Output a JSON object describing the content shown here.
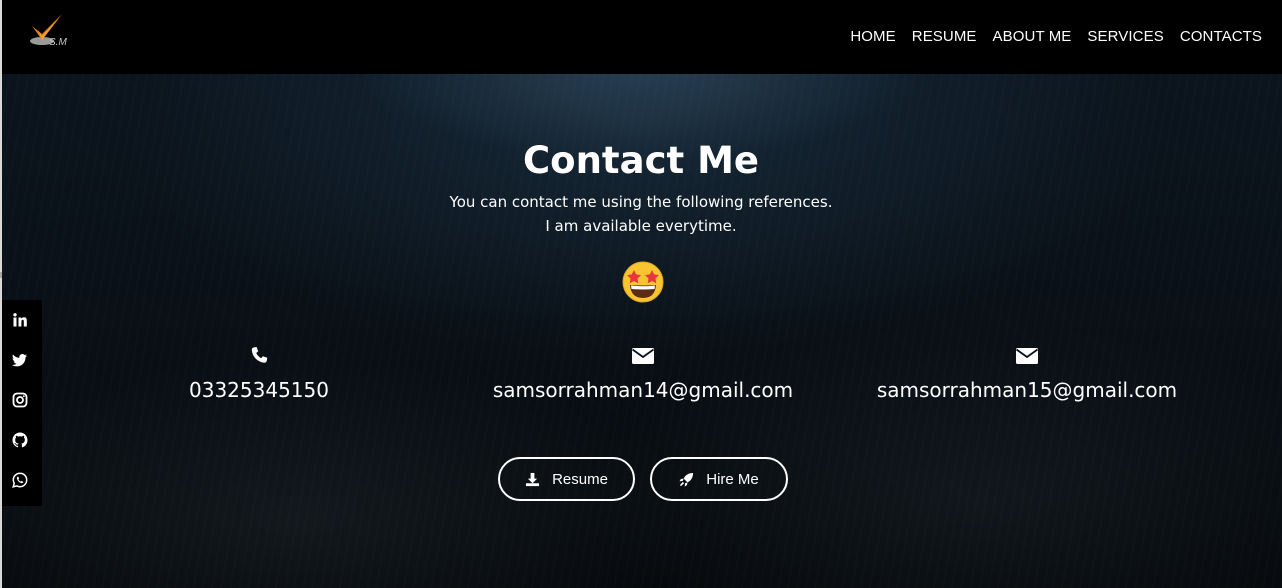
{
  "header": {
    "logo_text": "S.M",
    "nav": [
      {
        "label": "HOME"
      },
      {
        "label": "RESUME"
      },
      {
        "label": "ABOUT ME"
      },
      {
        "label": "SERVICES"
      },
      {
        "label": "CONTACTS"
      }
    ]
  },
  "hero": {
    "title": "Contact Me",
    "subtitle_line1": "You can contact me using the following references.",
    "subtitle_line2": "I am available everytime.",
    "emoji_icon": "star-struck-emoji"
  },
  "contacts": [
    {
      "icon": "phone-icon",
      "text": "03325345150"
    },
    {
      "icon": "envelope-icon",
      "text": "samsorrahman14@gmail.com"
    },
    {
      "icon": "envelope-icon",
      "text": "samsorrahman15@gmail.com"
    }
  ],
  "buttons": {
    "resume_label": "Resume",
    "resume_icon": "download-icon",
    "hire_label": "Hire Me",
    "hire_icon": "rocket-icon"
  },
  "social": [
    {
      "icon": "linkedin-icon"
    },
    {
      "icon": "twitter-icon"
    },
    {
      "icon": "instagram-icon"
    },
    {
      "icon": "github-icon"
    },
    {
      "icon": "whatsapp-icon"
    }
  ]
}
